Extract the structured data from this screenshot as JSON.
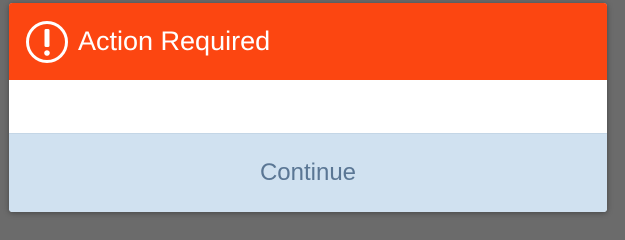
{
  "dialog": {
    "title": "Action Required",
    "icon": "exclamation-circle-icon",
    "continue_label": "Continue"
  },
  "colors": {
    "header_bg": "#fc4611",
    "button_bg": "#d0e1f0",
    "button_text": "#5a7694",
    "backdrop": "#6b6b6b"
  }
}
